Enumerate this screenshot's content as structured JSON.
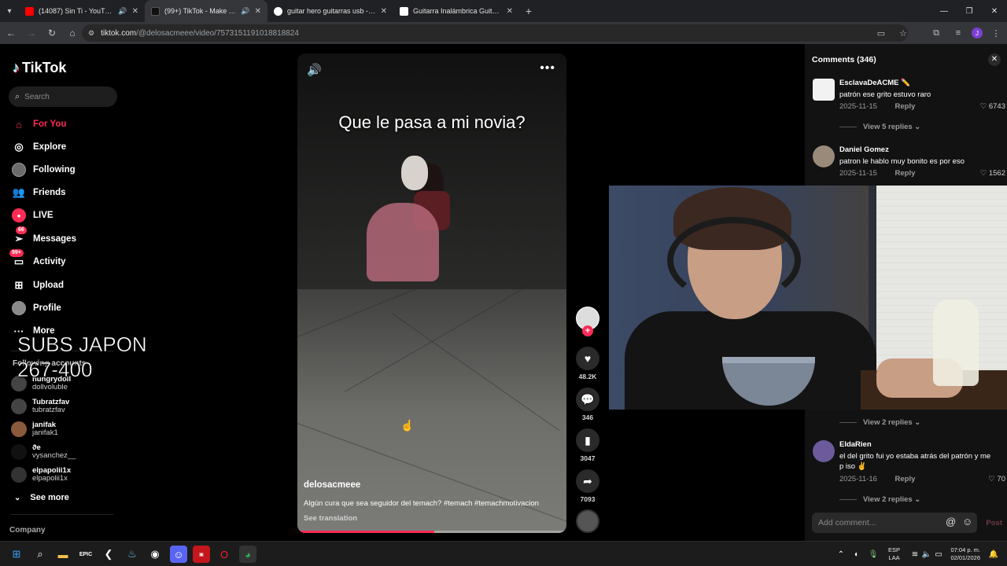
{
  "browser": {
    "tabs": [
      {
        "title": "(14087) Sin Ti - YouTube",
        "favicon_color": "#ff0000",
        "audio": true,
        "active": false
      },
      {
        "title": "(99+) TikTok - Make Your Da",
        "favicon_color": "#111111",
        "audio": true,
        "active": true
      },
      {
        "title": "guitar hero guitarras usb - Bus",
        "favicon_color": "#ffffff",
        "audio": false,
        "active": false
      },
      {
        "title": "Guitarra Inalámbrica Guitar Her",
        "favicon_color": "#ffffff",
        "audio": false,
        "active": false
      }
    ],
    "address": {
      "host": "tiktok.com",
      "path": "/@delosacmeee/video/7573151191018818824"
    },
    "profile_initial": "J"
  },
  "sidebar": {
    "logo": "TikTok",
    "search_placeholder": "Search",
    "nav": [
      {
        "label": "For You",
        "icon": "home-icon",
        "active": true
      },
      {
        "label": "Explore",
        "icon": "compass-icon"
      },
      {
        "label": "Following",
        "icon": "following-avatar-icon"
      },
      {
        "label": "Friends",
        "icon": "friends-icon"
      },
      {
        "label": "LIVE",
        "icon": "live-icon"
      },
      {
        "label": "Messages",
        "icon": "messages-icon",
        "badge": "66"
      },
      {
        "label": "Activity",
        "icon": "activity-icon",
        "badge": "99+"
      },
      {
        "label": "Upload",
        "icon": "upload-icon"
      },
      {
        "label": "Profile",
        "icon": "profile-avatar-icon"
      },
      {
        "label": "More",
        "icon": "more-dots-icon"
      }
    ],
    "following_title": "Following accounts",
    "following": [
      {
        "username": "hungrydoll",
        "name": "dollvoluble"
      },
      {
        "username": "Tubratzfav",
        "name": "tubratzfav"
      },
      {
        "username": "janifak",
        "name": "janifak1"
      },
      {
        "username": "ϑe",
        "name": "vysanchez__"
      },
      {
        "username": "elpapolii1x",
        "name": "elpapolii1x"
      }
    ],
    "see_more": "See more",
    "company": "Company",
    "stream_overlay": {
      "line1": "SUBS JAPON",
      "line2": "267-400"
    }
  },
  "video": {
    "title_text": "Que le pasa a mi novia?",
    "author": "delosacmeee",
    "caption": "Algún cura que sea seguidor del temach? #temach #temachmotivacion",
    "see_translation": "See translation",
    "progress": 0.51,
    "likes": "48.2K",
    "comments": "346",
    "saves": "3047",
    "shares": "7093"
  },
  "comments_panel": {
    "header": "Comments (346)",
    "items": [
      {
        "user": "EsclavaDeACME ✏️",
        "text": "patrón ese grito estuvo raro",
        "date": "2025-11-15",
        "reply": "Reply",
        "likes": "6743",
        "replies": "View 5 replies"
      },
      {
        "user": "Daniel Gomez",
        "text": "patron le hablo muy bonito es por eso",
        "date": "2025-11-15",
        "reply": "Reply",
        "likes": "1562",
        "replies": "View 2 replies"
      },
      {
        "user": "EldaRien",
        "text": "el del grito fui yo estaba atrás del patrón y me p iso ✌️",
        "date": "2025-11-16",
        "reply": "Reply",
        "likes": "70",
        "replies": "View 2 replies"
      }
    ],
    "input_placeholder": "Add comment...",
    "post": "Post"
  },
  "taskbar": {
    "lang_line1": "ESP",
    "lang_line2": "LAA",
    "time": "07:04 p. m.",
    "date": "02/01/2026"
  }
}
